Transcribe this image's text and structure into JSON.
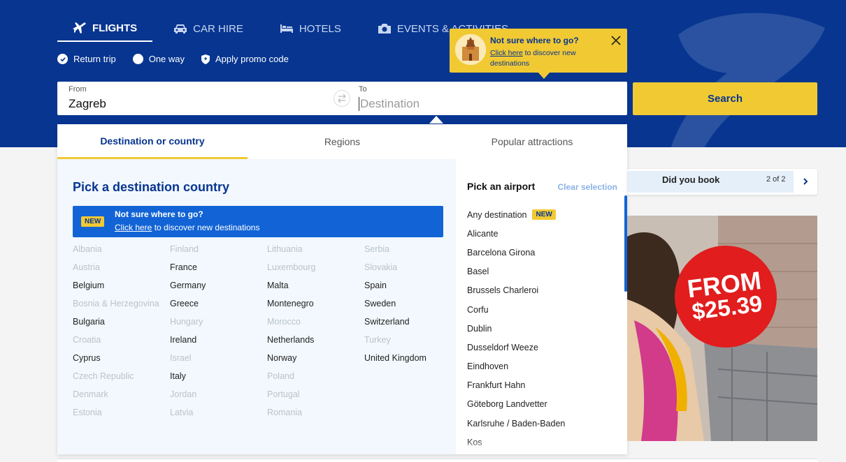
{
  "colors": {
    "brand_blue": "#073590",
    "accent_yellow": "#f1c933",
    "link_blue": "#1264d6",
    "promo_red": "#e11d1d"
  },
  "nav": {
    "tabs": [
      {
        "label": "FLIGHTS",
        "icon": "plane-icon",
        "active": true
      },
      {
        "label": "CAR HIRE",
        "icon": "car-icon"
      },
      {
        "label": "HOTELS",
        "icon": "bed-icon"
      },
      {
        "label": "EVENTS & ACTIVITIES",
        "icon": "camera-icon"
      }
    ]
  },
  "trip_options": {
    "return_trip": "Return trip",
    "one_way": "One way",
    "promo": "Apply promo code"
  },
  "search": {
    "from_label": "From",
    "from_value": "Zagreb",
    "to_label": "To",
    "to_placeholder": "Destination",
    "button": "Search"
  },
  "tooltip": {
    "title": "Not sure where to go?",
    "link": "Click here",
    "text": " to discover new destinations"
  },
  "panel": {
    "tabs": [
      "Destination or country",
      "Regions",
      "Popular attractions"
    ],
    "country_title": "Pick a destination country",
    "banner": {
      "badge": "NEW",
      "title": "Not sure where to go?",
      "link": "Click here",
      "text": " to discover new destinations"
    },
    "country_columns": [
      [
        {
          "name": "Albania",
          "disabled": true
        },
        {
          "name": "Austria",
          "disabled": true
        },
        {
          "name": "Belgium"
        },
        {
          "name": "Bosnia & Herzegovina",
          "disabled": true
        },
        {
          "name": "Bulgaria"
        },
        {
          "name": "Croatia",
          "disabled": true
        },
        {
          "name": "Cyprus"
        },
        {
          "name": "Czech Republic",
          "disabled": true
        },
        {
          "name": "Denmark",
          "disabled": true
        },
        {
          "name": "Estonia",
          "disabled": true
        }
      ],
      [
        {
          "name": "Finland",
          "disabled": true
        },
        {
          "name": "France"
        },
        {
          "name": "Germany"
        },
        {
          "name": "Greece"
        },
        {
          "name": "Hungary",
          "disabled": true
        },
        {
          "name": "Ireland"
        },
        {
          "name": "Israel",
          "disabled": true
        },
        {
          "name": "Italy"
        },
        {
          "name": "Jordan",
          "disabled": true
        },
        {
          "name": "Latvia",
          "disabled": true
        }
      ],
      [
        {
          "name": "Lithuania",
          "disabled": true
        },
        {
          "name": "Luxembourg",
          "disabled": true
        },
        {
          "name": "Malta"
        },
        {
          "name": "Montenegro"
        },
        {
          "name": "Morocco",
          "disabled": true
        },
        {
          "name": "Netherlands"
        },
        {
          "name": "Norway"
        },
        {
          "name": "Poland",
          "disabled": true
        },
        {
          "name": "Portugal",
          "disabled": true
        },
        {
          "name": "Romania",
          "disabled": true
        }
      ],
      [
        {
          "name": "Serbia",
          "disabled": true
        },
        {
          "name": "Slovakia",
          "disabled": true
        },
        {
          "name": "Spain"
        },
        {
          "name": "Sweden"
        },
        {
          "name": "Switzerland"
        },
        {
          "name": "Turkey",
          "disabled": true
        },
        {
          "name": "United Kingdom"
        }
      ]
    ],
    "airport_title": "Pick an airport",
    "clear_selection": "Clear selection",
    "airports": [
      {
        "name": "Any destination",
        "badge": "NEW"
      },
      {
        "name": "Alicante"
      },
      {
        "name": "Barcelona Girona"
      },
      {
        "name": "Basel"
      },
      {
        "name": "Brussels Charleroi"
      },
      {
        "name": "Corfu"
      },
      {
        "name": "Dublin"
      },
      {
        "name": "Dusseldorf Weeze"
      },
      {
        "name": "Eindhoven"
      },
      {
        "name": "Frankfurt Hahn"
      },
      {
        "name": "Göteborg Landvetter"
      },
      {
        "name": "Karlsruhe / Baden-Baden"
      },
      {
        "name": "Kos"
      }
    ]
  },
  "did_you_book": {
    "text": "Did you book",
    "count": "2 of 2"
  },
  "promo": {
    "line1": "FROM",
    "line2": "$25.39"
  }
}
